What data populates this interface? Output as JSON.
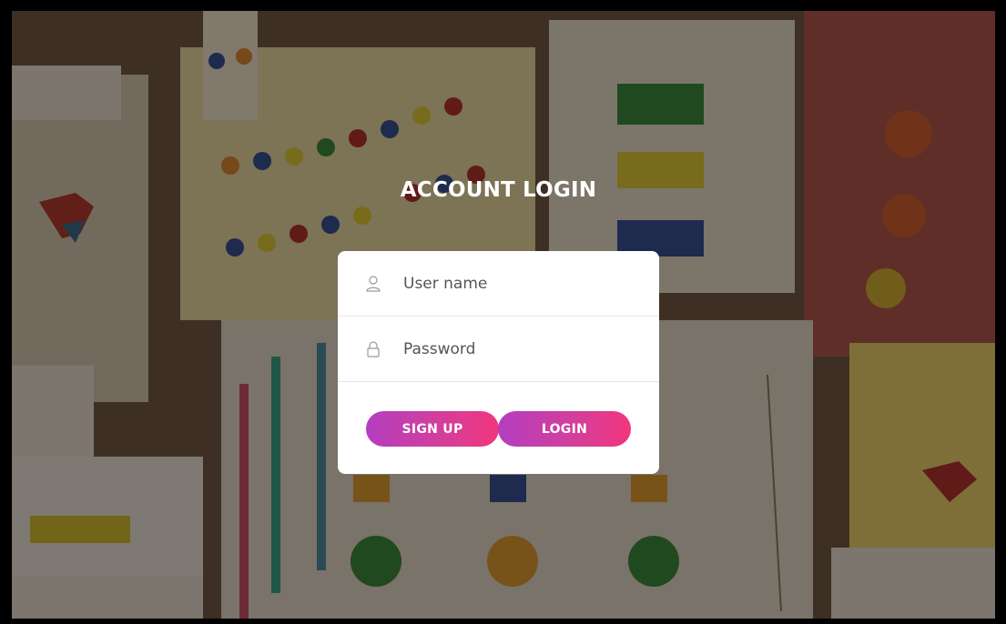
{
  "heading": "ACCOUNT LOGIN",
  "form": {
    "username_placeholder": "User name",
    "password_placeholder": "Password",
    "signup_label": "SIGN UP",
    "login_label": "LOGIN"
  },
  "icons": {
    "username": "user-icon",
    "password": "lock-icon"
  },
  "colors": {
    "button_gradient_start": "#b43ec0",
    "button_gradient_end": "#f2357e",
    "card_background": "#ffffff",
    "heading": "#ffffff"
  }
}
